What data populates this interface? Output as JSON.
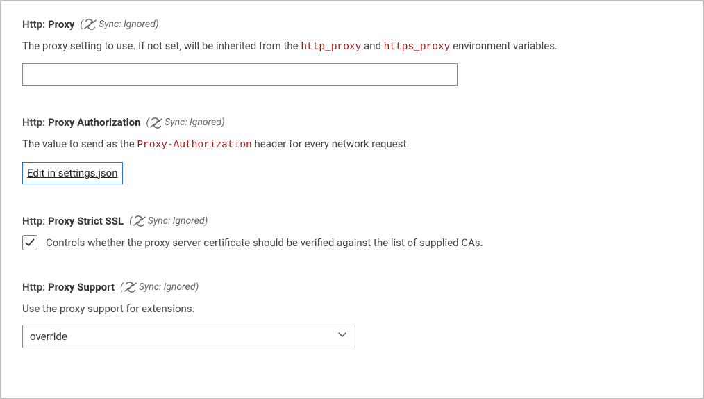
{
  "sync_label": "Sync: Ignored",
  "settings": {
    "proxy": {
      "category": "Http",
      "name": "Proxy",
      "desc_before": "The proxy setting to use. If not set, will be inherited from the ",
      "code1": "http_proxy",
      "desc_mid": " and ",
      "code2": "https_proxy",
      "desc_after": " environment variables.",
      "value": ""
    },
    "proxyAuth": {
      "category": "Http",
      "name": "Proxy Authorization",
      "desc_before": "The value to send as the ",
      "code1": "Proxy-Authorization",
      "desc_after": " header for every network request.",
      "edit_link": "Edit in settings.json"
    },
    "proxyStrictSSL": {
      "category": "Http",
      "name": "Proxy Strict SSL",
      "checked": true,
      "desc": "Controls whether the proxy server certificate should be verified against the list of supplied CAs."
    },
    "proxySupport": {
      "category": "Http",
      "name": "Proxy Support",
      "desc": "Use the proxy support for extensions.",
      "value": "override"
    }
  }
}
